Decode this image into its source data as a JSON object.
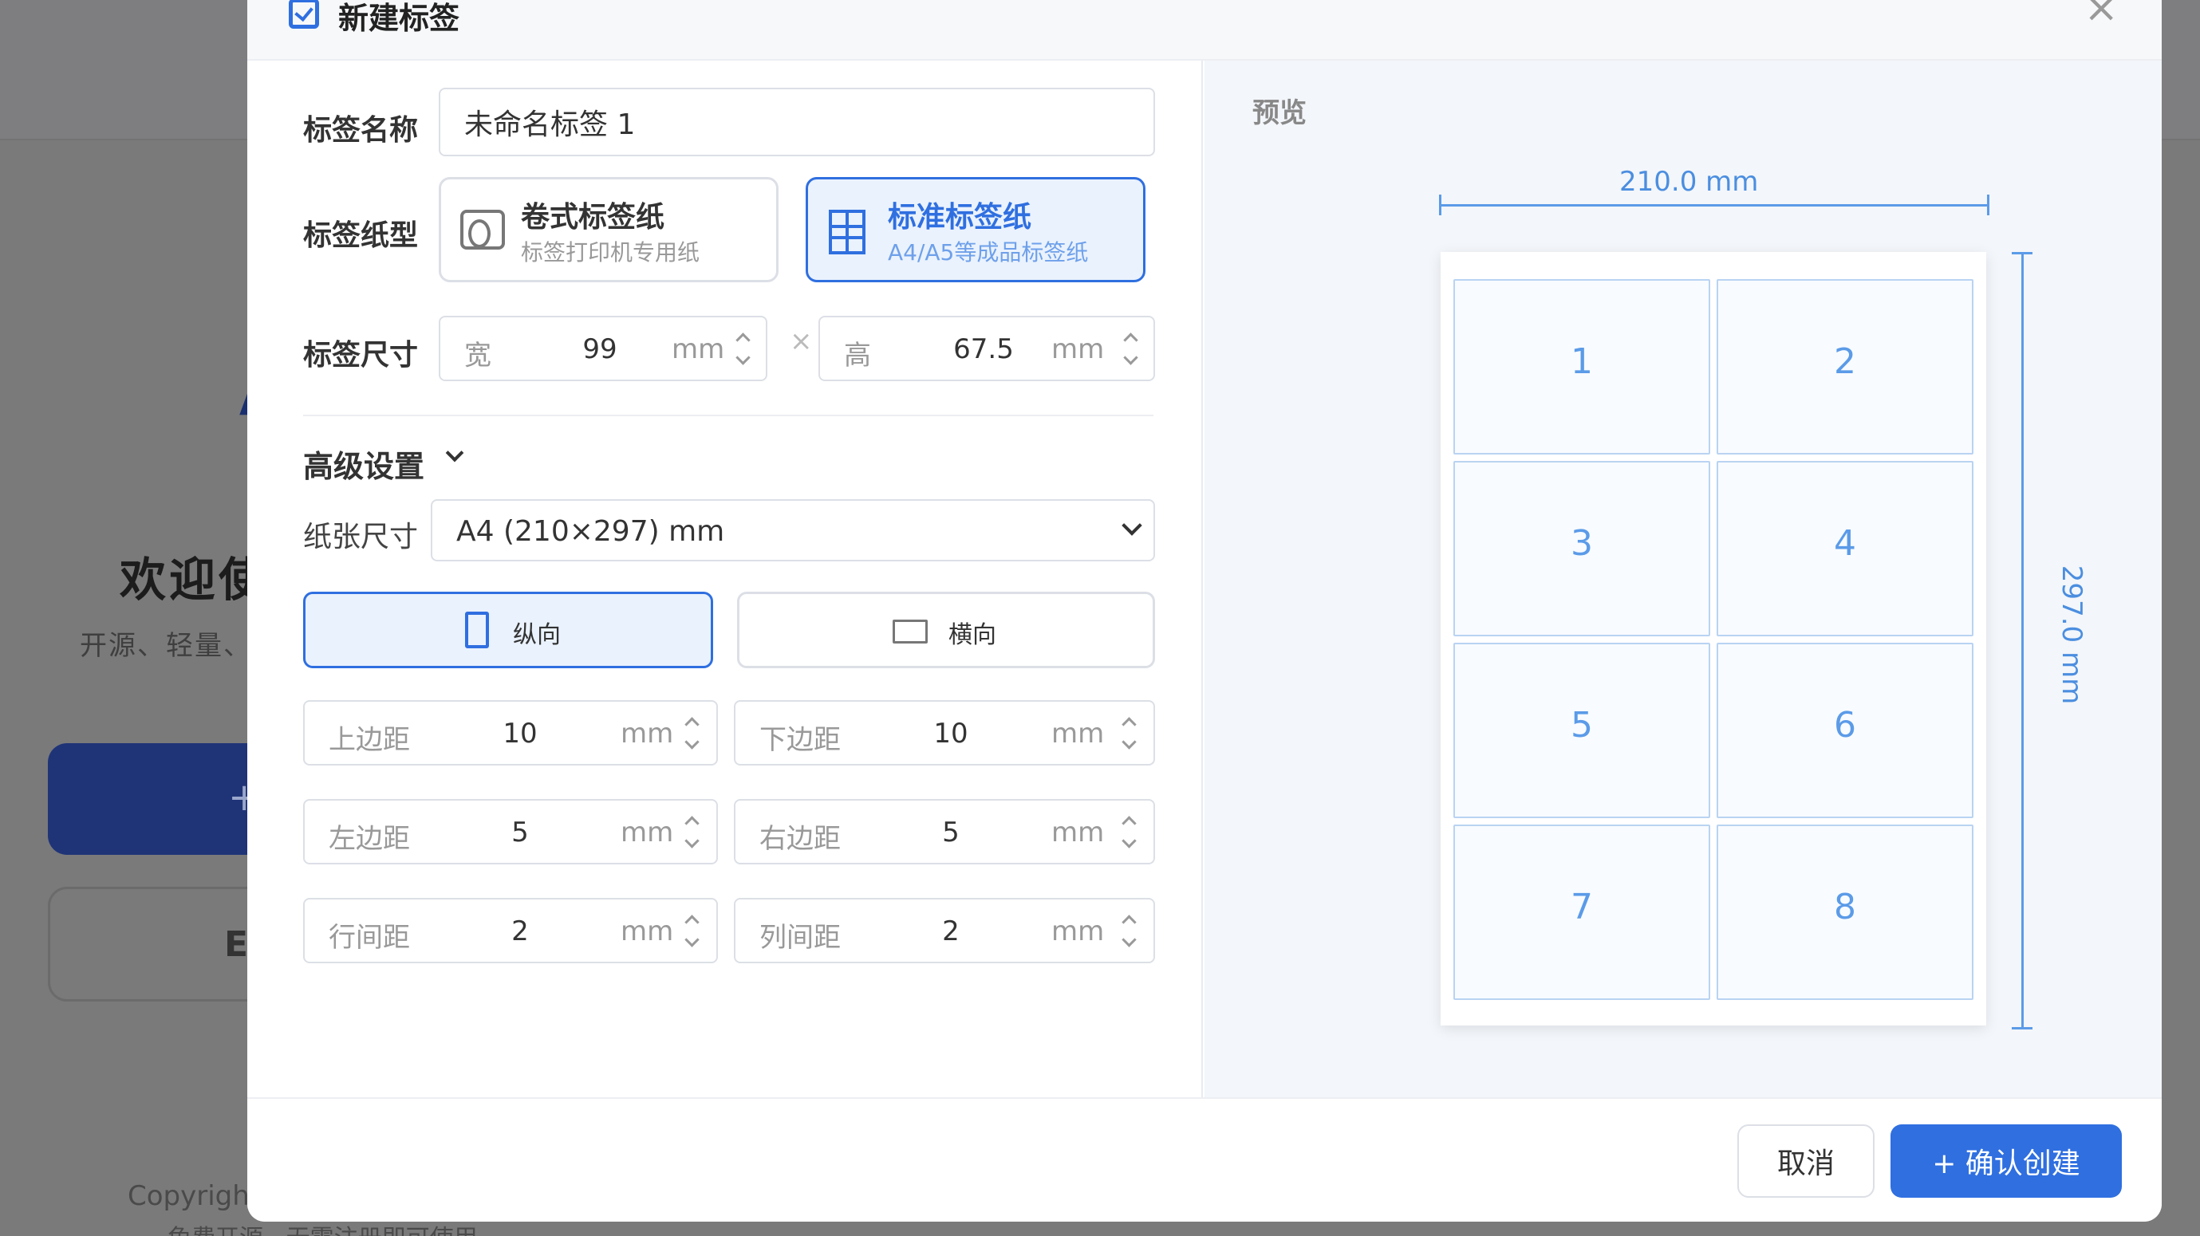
{
  "background": {
    "welcome": "欢迎使",
    "subtitle": "开源、轻量、",
    "primary_btn": "+",
    "secondary_btn": "E",
    "accent_char": "A",
    "footer_line1": "Copyright",
    "footer_line2": "免费开源 · 无需注册即可使用"
  },
  "modal": {
    "title": "新建标签",
    "close_icon": "close-icon",
    "label_name": {
      "label": "标签名称",
      "value": "未命名标签 1"
    },
    "paper_type": {
      "label": "标签纸型",
      "options": [
        {
          "title": "卷式标签纸",
          "subtitle": "标签打印机专用纸",
          "active": false,
          "icon": "roll-paper-icon"
        },
        {
          "title": "标准标签纸",
          "subtitle": "A4/A5等成品标签纸",
          "active": true,
          "icon": "grid-sheet-icon"
        }
      ]
    },
    "label_size": {
      "label": "标签尺寸",
      "width": {
        "prefix": "宽",
        "value": "99",
        "unit": "mm"
      },
      "times": "×",
      "height": {
        "prefix": "高",
        "value": "67.5",
        "unit": "mm"
      }
    },
    "advanced": {
      "title": "高级设置",
      "paper_size": {
        "label": "纸张尺寸",
        "value": "A4 (210×297) mm"
      },
      "orientation": {
        "portrait": {
          "label": "纵向",
          "active": true
        },
        "landscape": {
          "label": "横向",
          "active": false
        }
      },
      "margins": [
        {
          "name": "上边距",
          "value": "10",
          "unit": "mm"
        },
        {
          "name": "下边距",
          "value": "10",
          "unit": "mm"
        },
        {
          "name": "左边距",
          "value": "5",
          "unit": "mm"
        },
        {
          "name": "右边距",
          "value": "5",
          "unit": "mm"
        },
        {
          "name": "行间距",
          "value": "2",
          "unit": "mm"
        },
        {
          "name": "列间距",
          "value": "2",
          "unit": "mm"
        }
      ]
    },
    "preview": {
      "title": "预览",
      "width_label": "210.0 mm",
      "height_label": "297.0 mm",
      "cells": [
        "1",
        "2",
        "3",
        "4",
        "5",
        "6",
        "7",
        "8"
      ]
    },
    "footer": {
      "cancel": "取消",
      "confirm": "+ 确认创建"
    }
  },
  "colors": {
    "accent": "#2f6fe0",
    "preview_line": "#5b9be8",
    "overlay": "#7a7a7b"
  }
}
